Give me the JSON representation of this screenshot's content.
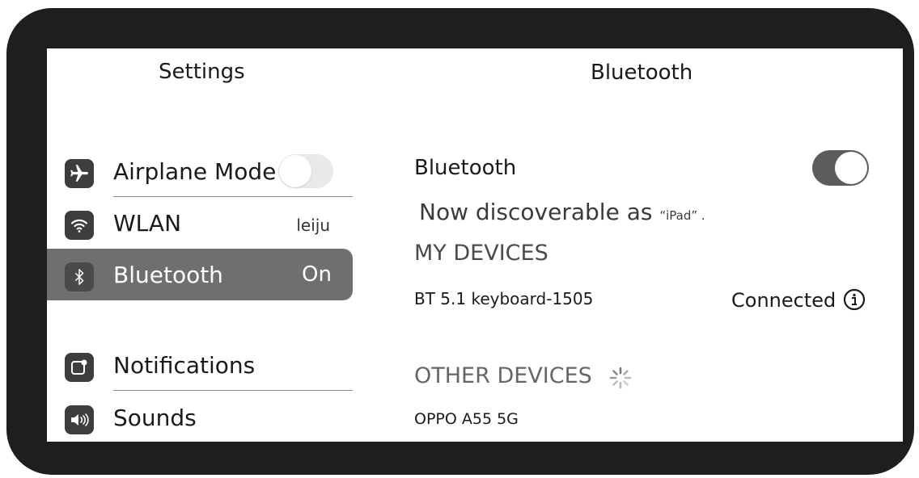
{
  "left_panel": {
    "title": "Settings",
    "items": [
      {
        "label": "Airplane Mode",
        "icon": "airplane-icon",
        "toggle": "off"
      },
      {
        "label": "WLAN",
        "value": "leiju",
        "icon": "wifi-icon"
      },
      {
        "label": "Bluetooth",
        "value": "On",
        "icon": "bluetooth-icon",
        "selected": true
      },
      {
        "label": "Notifications",
        "icon": "notifications-icon"
      },
      {
        "label": "Sounds",
        "icon": "speaker-icon"
      }
    ]
  },
  "right_panel": {
    "title": "Bluetooth",
    "bluetooth_label": "Bluetooth",
    "bluetooth_toggle": "on",
    "discoverable_text": "Now discoverable as",
    "discoverable_name": "“iPad” .",
    "my_devices_header": "MY DEVICES",
    "my_devices": [
      {
        "name": "BT 5.1 keyboard-1505",
        "status": "Connected"
      }
    ],
    "other_devices_header": "OTHER DEVICES",
    "other_devices": [
      {
        "name": "OPPO A55 5G"
      }
    ]
  },
  "colors": {
    "bezel": "#1e1e1e",
    "selected_row": "#6f6f6f",
    "toggle_on": "#5c5c5c",
    "toggle_off": "#e9e9e9"
  }
}
